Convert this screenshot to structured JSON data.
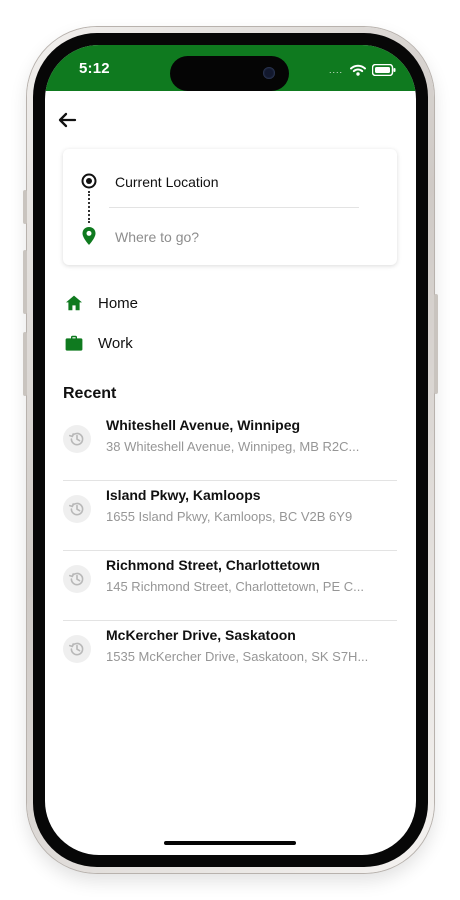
{
  "status_bar": {
    "time": "5:12",
    "signal": "....",
    "wifi_icon": "wifi-icon",
    "battery_icon": "battery-icon",
    "background": "#0f7a1f"
  },
  "navigation": {
    "back_icon": "arrow-left-icon"
  },
  "route_card": {
    "origin_label": "Current Location",
    "origin_icon": "target-icon",
    "destination_placeholder": "Where to go?",
    "destination_value": "",
    "destination_icon": "map-pin-icon",
    "destination_icon_color": "#0f7a1f"
  },
  "saved_places": [
    {
      "label": "Home",
      "icon": "home-icon",
      "color": "#0f7a1f"
    },
    {
      "label": "Work",
      "icon": "briefcase-icon",
      "color": "#0f7a1f"
    }
  ],
  "recent": {
    "title": "Recent",
    "icon": "history-icon",
    "items": [
      {
        "name": "Whiteshell Avenue, Winnipeg",
        "address": "38 Whiteshell Avenue, Winnipeg, MB R2C..."
      },
      {
        "name": "Island Pkwy, Kamloops",
        "address": "1655 Island Pkwy, Kamloops, BC V2B 6Y9"
      },
      {
        "name": "Richmond Street, Charlottetown",
        "address": "145 Richmond Street, Charlottetown, PE C..."
      },
      {
        "name": "McKercher Drive, Saskatoon",
        "address": "1535 McKercher Drive, Saskatoon, SK S7H..."
      }
    ]
  },
  "home_indicator": "home-indicator"
}
